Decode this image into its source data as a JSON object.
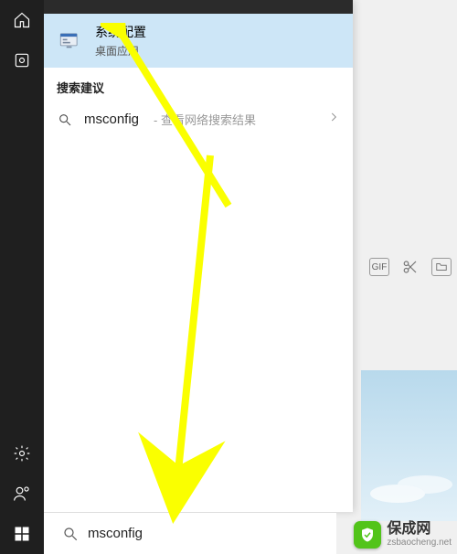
{
  "panel": {
    "best_match": {
      "title": "系统配置",
      "subtitle": "桌面应用"
    },
    "section_label": "搜索建议",
    "suggestion": {
      "term": "msconfig",
      "hint": " - 查看网络搜索结果"
    }
  },
  "search": {
    "value": "msconfig"
  },
  "toolbar": {
    "gif": "GIF"
  },
  "watermark": {
    "name": "保成网",
    "domain": "zsbaocheng.net"
  }
}
